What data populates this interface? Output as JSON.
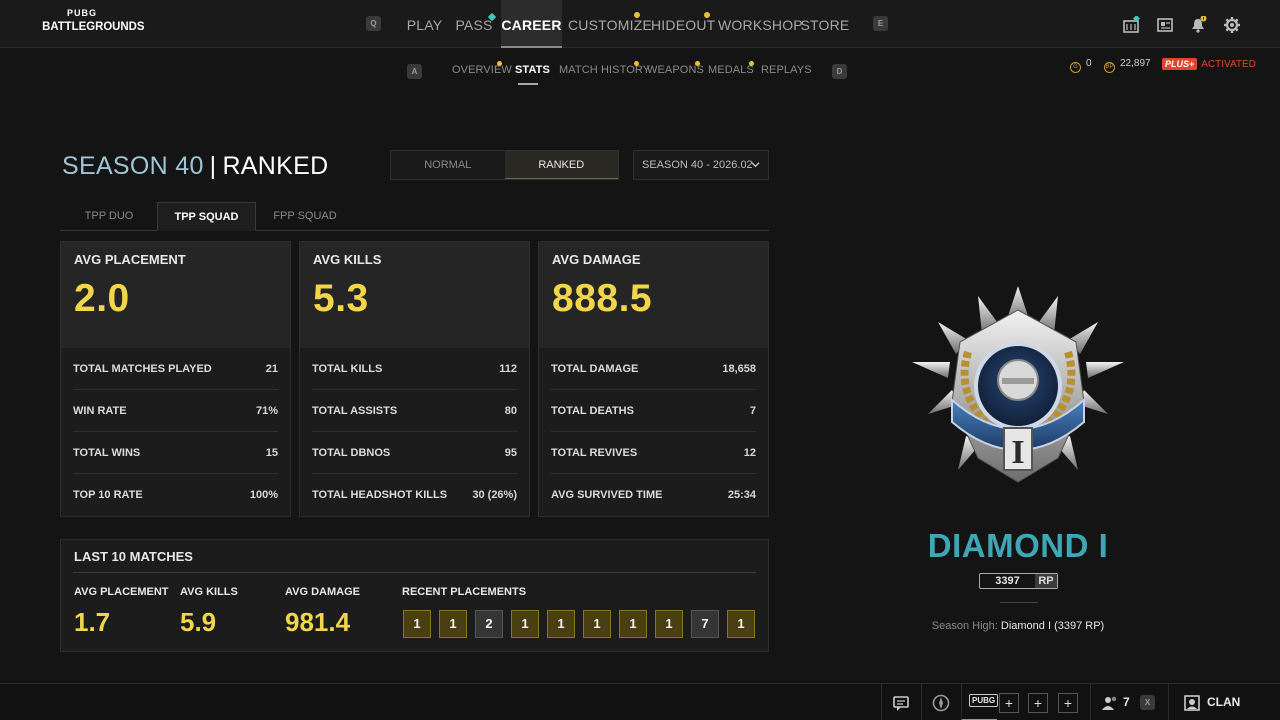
{
  "app": {
    "logo_top": "PUBG",
    "logo_bottom": "BATTLEGROUNDS"
  },
  "top_nav": {
    "prev_key": "Q",
    "next_key": "E",
    "items": [
      {
        "label": "PLAY"
      },
      {
        "label": "PASS"
      },
      {
        "label": "CAREER"
      },
      {
        "label": "CUSTOMIZE"
      },
      {
        "label": "HIDEOUT"
      },
      {
        "label": "WORKSHOP"
      },
      {
        "label": "STORE"
      }
    ],
    "active": "CAREER"
  },
  "sub_nav": {
    "prev_key": "A",
    "next_key": "D",
    "items": [
      {
        "label": "OVERVIEW"
      },
      {
        "label": "STATS"
      },
      {
        "label": "MATCH HISTORY"
      },
      {
        "label": "WEAPONS"
      },
      {
        "label": "MEDALS"
      },
      {
        "label": "REPLAYS"
      }
    ],
    "active": "STATS"
  },
  "currency": {
    "g_coin": "0",
    "bp": "22,897",
    "plus_label": "PLUS+",
    "plus_status": "ACTIVATED",
    "g_symbol": "G",
    "bp_symbol": "BP"
  },
  "header": {
    "season": "SEASON 40",
    "separator": "|",
    "mode": "RANKED",
    "toggle": [
      "NORMAL",
      "RANKED"
    ],
    "toggle_active": "RANKED",
    "season_select": "SEASON 40 - 2026.02"
  },
  "tabs": [
    {
      "label": "TPP DUO"
    },
    {
      "label": "TPP SQUAD"
    },
    {
      "label": "FPP SQUAD"
    }
  ],
  "tab_active": "TPP SQUAD",
  "cards": [
    {
      "label": "AVG PLACEMENT",
      "value": "2.0",
      "rows": [
        {
          "label": "TOTAL MATCHES PLAYED",
          "value": "21"
        },
        {
          "label": "WIN RATE",
          "value": "71%"
        },
        {
          "label": "TOTAL WINS",
          "value": "15"
        },
        {
          "label": "TOP 10 RATE",
          "value": "100%"
        }
      ]
    },
    {
      "label": "AVG KILLS",
      "value": "5.3",
      "rows": [
        {
          "label": "TOTAL KILLS",
          "value": "112"
        },
        {
          "label": "TOTAL ASSISTS",
          "value": "80"
        },
        {
          "label": "TOTAL DBNOS",
          "value": "95"
        },
        {
          "label": "TOTAL HEADSHOT KILLS",
          "value": "30 (26%)"
        }
      ]
    },
    {
      "label": "AVG DAMAGE",
      "value": "888.5",
      "rows": [
        {
          "label": "TOTAL DAMAGE",
          "value": "18,658"
        },
        {
          "label": "TOTAL DEATHS",
          "value": "7"
        },
        {
          "label": "TOTAL REVIVES",
          "value": "12"
        },
        {
          "label": "AVG SURVIVED TIME",
          "value": "25:34"
        }
      ]
    }
  ],
  "last10": {
    "title": "LAST 10 MATCHES",
    "avg_placement_label": "AVG PLACEMENT",
    "avg_placement": "1.7",
    "avg_kills_label": "AVG KILLS",
    "avg_kills": "5.9",
    "avg_damage_label": "AVG DAMAGE",
    "avg_damage": "981.4",
    "recent_label": "RECENT PLACEMENTS",
    "placements": [
      "1",
      "1",
      "2",
      "1",
      "1",
      "1",
      "1",
      "1",
      "7",
      "1"
    ]
  },
  "rank": {
    "tier": "DIAMOND I",
    "emblem_numeral": "I",
    "rp": "3397",
    "rp_unit": "RP",
    "season_high_label": "Season High:",
    "season_high_value": "Diamond I (3397 RP)"
  },
  "bottom_bar": {
    "friends_count": "7",
    "friends_key": "X",
    "clan_label": "CLAN",
    "pubg_tag": "PUBG",
    "plus": "+"
  },
  "colors": {
    "accent_yellow": "#f1d54b",
    "rank_teal": "#3fa6b5",
    "season_blue": "#9fc4d4",
    "plus_red": "#e0452b"
  }
}
